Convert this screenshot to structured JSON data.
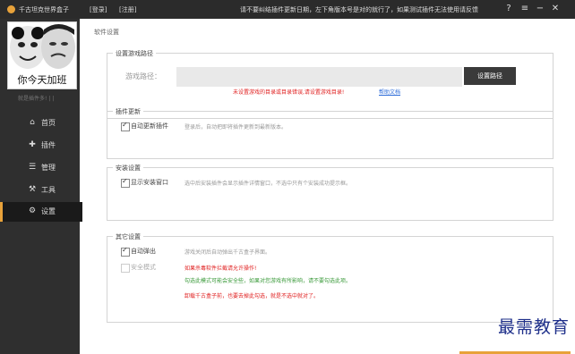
{
  "titlebar": {
    "app_title": "千古坦克世界盒子",
    "login": "[登录]",
    "register": "[注册]",
    "notice": "请不要纠结插件更新日期，左下角版本号是对的就行了，如果测试插件无法使用请反馈",
    "icons": [
      "help-icon",
      "menu-icon",
      "minimize-icon",
      "close-icon"
    ]
  },
  "sidebar": {
    "avatar_caption": "你今天加班",
    "status_text": "就是插件多! | |",
    "items": [
      {
        "label": "首页",
        "icon": "home-icon"
      },
      {
        "label": "插件",
        "icon": "puzzle-icon"
      },
      {
        "label": "管理",
        "icon": "manage-icon"
      },
      {
        "label": "工具",
        "icon": "wrench-icon"
      },
      {
        "label": "设置",
        "icon": "gear-icon",
        "active": true
      }
    ]
  },
  "main": {
    "page_title": "软件设置",
    "game_path": {
      "title": "设置游戏路径",
      "label": "游戏路径：",
      "value": "",
      "button": "设置路径",
      "warning": "未设置游戏的目录或目录错误,请设置游戏目录!",
      "help_link": "帮助文档"
    },
    "plugin_update": {
      "title": "插件更新",
      "checkbox_label": "自动更新插件",
      "checked": true,
      "desc": "登录后，自动把即将插件更新到最新版本。"
    },
    "install": {
      "title": "安装设置",
      "checkbox_label": "显示安装窗口",
      "checked": true,
      "desc": "选中后安装插件会显示插件详情窗口，不选中只有个安装成功提示框。"
    },
    "other": {
      "title": "其它设置",
      "auto_popup_label": "自动弹出",
      "auto_popup_checked": true,
      "auto_popup_desc": "游戏关闭后自动弹出千古盒子界面。",
      "safe_mode_label": "安全模式",
      "safe_mode_checked": false,
      "safe_mode_line1": "如果杀毒软件拦截请允许操作!",
      "safe_mode_line2": "勾选此模式可能会安全些，如果对您游戏有所影响，请不要勾选此项。",
      "safe_mode_line3": "卸载千古盒子前，也要去掉此勾选，就是不选中就对了。"
    }
  },
  "watermark": "最需教育",
  "colors": {
    "accent": "#e8a23a",
    "sidebar": "#2f2f2f",
    "warning": "#e02020",
    "link": "#2a6ad8",
    "green": "#3a9a3a"
  }
}
